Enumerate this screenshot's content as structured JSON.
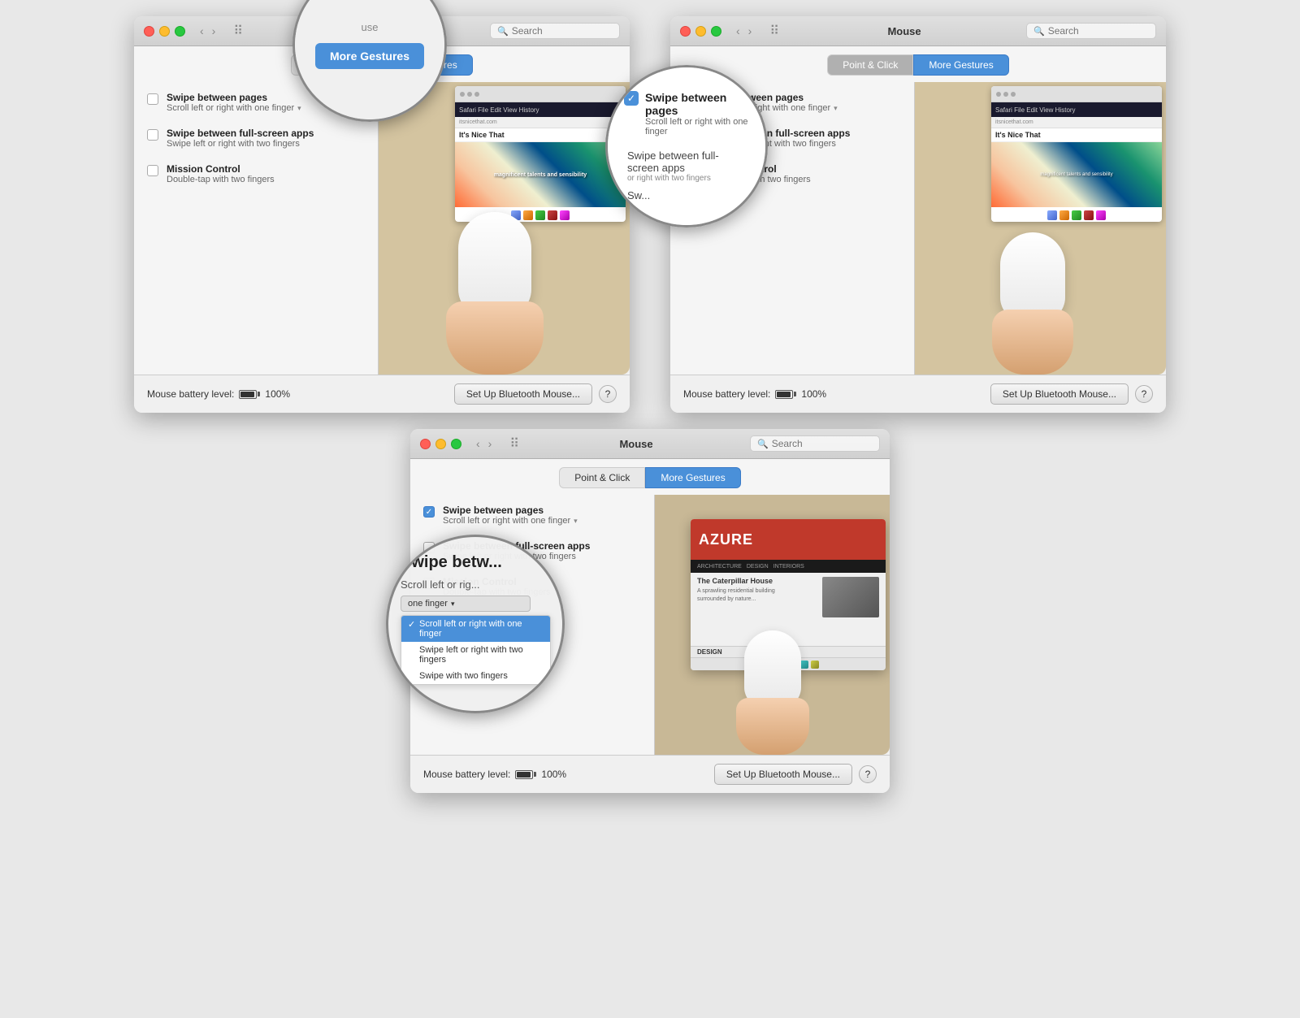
{
  "app": {
    "title": "Mouse",
    "search_placeholder": "Search"
  },
  "tabs": {
    "point_click": "Point & Click",
    "more_gestures": "More Gestures"
  },
  "gestures": [
    {
      "id": "swipe_pages",
      "label": "Swipe between pages",
      "sublabel": "Scroll left or right with one finger",
      "checked": false,
      "has_dropdown": true
    },
    {
      "id": "swipe_fullscreen",
      "label": "Swipe between full-screen apps",
      "sublabel": "Swipe left or right with two fingers",
      "checked": false,
      "has_dropdown": false
    },
    {
      "id": "mission_control",
      "label": "Mission Control",
      "sublabel": "Double-tap with two fingers",
      "checked": false,
      "has_dropdown": false
    }
  ],
  "battery": {
    "label": "Mouse battery level:",
    "level": "100%"
  },
  "buttons": {
    "setup": "Set Up Bluetooth Mouse...",
    "help": "?"
  },
  "magnifier_window1": {
    "active_tab": "More Gestures"
  },
  "magnifier_window2": {
    "checkbox_checked": true,
    "item1_label": "Swipe between pages",
    "item1_sub": "Scroll left or right with one finger",
    "item2_label": "Swipe between full-screen apps",
    "item2_sub": "Swipe left or right with two fingers"
  },
  "magnifier_bottom": {
    "title": "Swipe between pages",
    "dropdown_label": "Scroll left or right",
    "dropdown_options": [
      "Scroll left or right with one finger",
      "Swipe left or right with two fingers",
      "Swipe with"
    ],
    "selected_option": "Scroll left or right with one finger"
  },
  "dropdown_popup": {
    "items": [
      {
        "label": "Scroll left or right with one finger",
        "selected": true
      },
      {
        "label": "Swipe left or right with two fingers",
        "selected": false
      },
      {
        "label": "Swipe with two fingers",
        "selected": false
      }
    ]
  },
  "azure": {
    "title": "AZURE",
    "subtitle": "DESIGN",
    "article_title": "The Caterpillar House"
  }
}
